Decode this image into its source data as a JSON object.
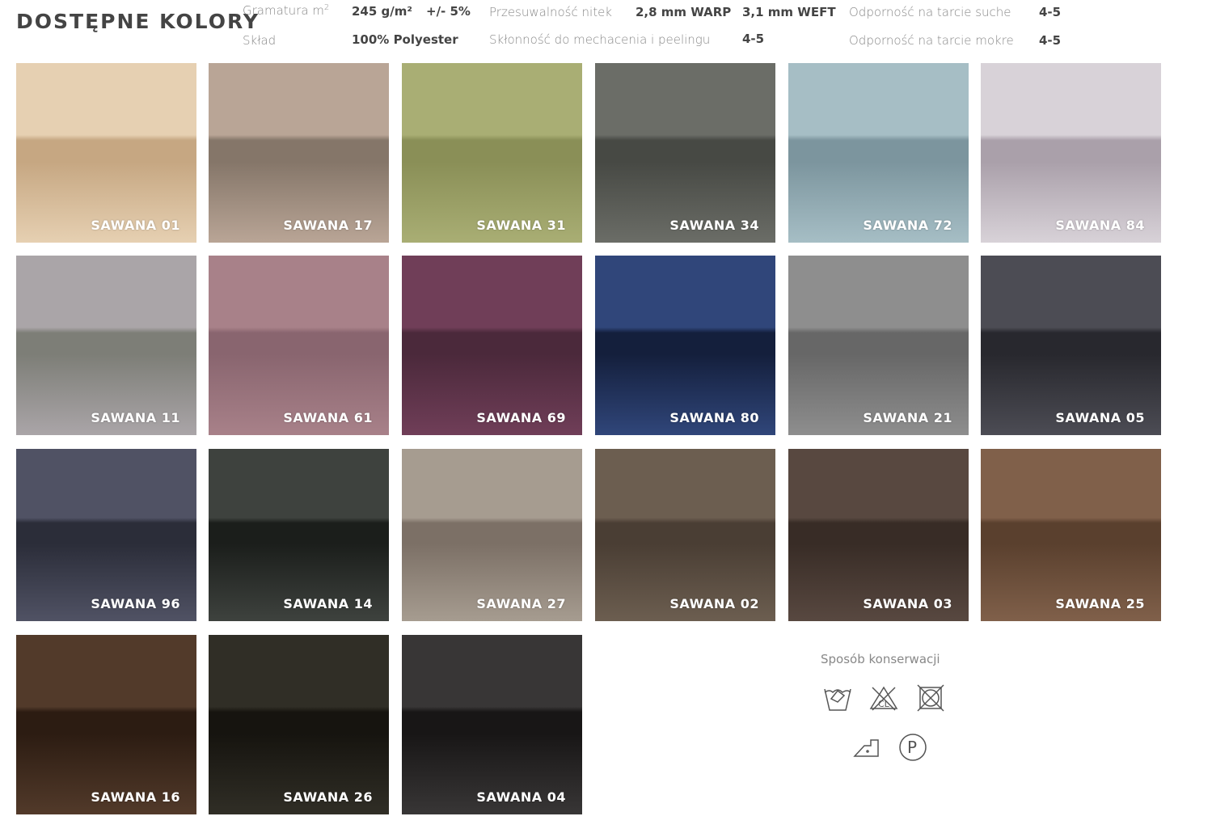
{
  "header": {
    "title": "DOSTĘPNE KOLORY",
    "specs": [
      {
        "label": "Gramatura m²",
        "values": [
          "245 g/m²",
          "+/- 5%"
        ]
      },
      {
        "label": "Skład",
        "values": [
          "100% Polyester"
        ]
      },
      {
        "label": "Przesuwalność nitek",
        "values": [
          "2,8 mm WARP",
          "3,1 mm WEFT"
        ]
      },
      {
        "label": "Skłonność do mechacenia i peelingu",
        "values": [
          "4-5"
        ]
      },
      {
        "label": "Odporność na tarcie suche",
        "values": [
          "4-5"
        ]
      },
      {
        "label": "Odporność na tarcie mokre",
        "values": [
          "4-5"
        ]
      }
    ]
  },
  "swatches": [
    {
      "name": "SAWANA 01",
      "top": "#e6d0b2",
      "bottom": "#c6a782"
    },
    {
      "name": "SAWANA 17",
      "top": "#b9a596",
      "bottom": "#857669"
    },
    {
      "name": "SAWANA 31",
      "top": "#a9ae74",
      "bottom": "#8a8f57"
    },
    {
      "name": "SAWANA 34",
      "top": "#6b6d67",
      "bottom": "#474944"
    },
    {
      "name": "SAWANA 72",
      "top": "#a6bec5",
      "bottom": "#7c959e"
    },
    {
      "name": "SAWANA 84",
      "top": "#d8d2d8",
      "bottom": "#aaa0aa"
    },
    {
      "name": "SAWANA 11",
      "top": "#aaa5a8",
      "bottom": "#7d7e77"
    },
    {
      "name": "SAWANA 61",
      "top": "#a88189",
      "bottom": "#89656f"
    },
    {
      "name": "SAWANA 69",
      "top": "#703e58",
      "bottom": "#4b293b"
    },
    {
      "name": "SAWANA 80",
      "top": "#30467a",
      "bottom": "#141f3c"
    },
    {
      "name": "SAWANA 21",
      "top": "#8e8e8e",
      "bottom": "#676767"
    },
    {
      "name": "SAWANA 05",
      "top": "#4c4c54",
      "bottom": "#28282e"
    },
    {
      "name": "SAWANA 96",
      "top": "#505264",
      "bottom": "#2b2d39"
    },
    {
      "name": "SAWANA 14",
      "top": "#3e423e",
      "bottom": "#1b1e1b"
    },
    {
      "name": "SAWANA 27",
      "top": "#a69c90",
      "bottom": "#7c7066"
    },
    {
      "name": "SAWANA 02",
      "top": "#6c5e50",
      "bottom": "#4a3e34"
    },
    {
      "name": "SAWANA 03",
      "top": "#584840",
      "bottom": "#382c26"
    },
    {
      "name": "SAWANA 25",
      "top": "#80604a",
      "bottom": "#5a402e"
    },
    {
      "name": "SAWANA 16",
      "top": "#523a2a",
      "bottom": "#2c1c12"
    },
    {
      "name": "SAWANA 26",
      "top": "#302e26",
      "bottom": "#16140f"
    },
    {
      "name": "SAWANA 04",
      "top": "#383636",
      "bottom": "#181616"
    }
  ],
  "care": {
    "title": "Sposób konserwacji",
    "icons": [
      "hand-wash-icon",
      "no-bleach-icon",
      "no-tumble-dry-icon",
      "iron-low-icon",
      "dry-clean-p-icon"
    ]
  }
}
